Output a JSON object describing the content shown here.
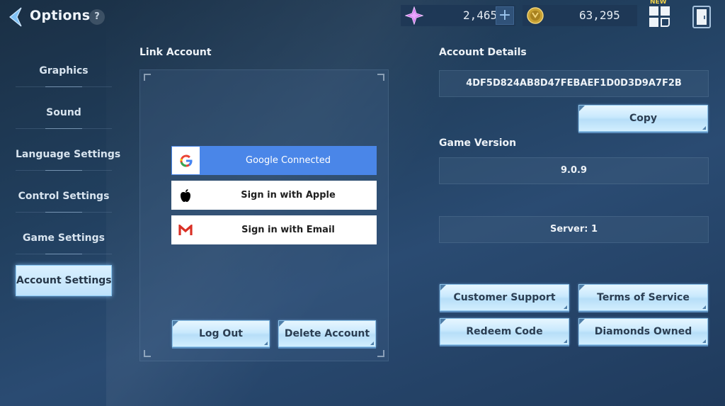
{
  "header": {
    "title": "Options",
    "help_label": "?",
    "back_icon": "chevron-left-icon",
    "currencies": [
      {
        "name": "diamonds",
        "icon": "purple-crystal-icon",
        "value": "2,465",
        "add_label": "+"
      },
      {
        "name": "gold",
        "icon": "gold-coin-icon",
        "value": "63,295"
      }
    ],
    "new_badge": "NEW",
    "menu_icon": "grid-menu-icon",
    "exit_icon": "door-exit-icon"
  },
  "sidebar": {
    "items": [
      {
        "label": "Graphics",
        "active": false
      },
      {
        "label": "Sound",
        "active": false
      },
      {
        "label": "Language Settings",
        "active": false
      },
      {
        "label": "Control Settings",
        "active": false
      },
      {
        "label": "Game Settings",
        "active": false
      },
      {
        "label": "Account Settings",
        "active": true
      }
    ]
  },
  "link_account": {
    "title": "Link Account",
    "providers": [
      {
        "label": "Google Connected",
        "icon": "google-icon",
        "connected": true,
        "color": "#4a86e8"
      },
      {
        "label": "Sign in with Apple",
        "icon": "apple-icon",
        "connected": false
      },
      {
        "label": "Sign in with Email",
        "icon": "gmail-icon",
        "connected": false
      }
    ],
    "logout_label": "Log Out",
    "delete_label": "Delete Account"
  },
  "account_details": {
    "title": "Account Details",
    "account_id": "4DF5D824AB8D47FEBAEF1D0D3D9A7F2B",
    "copy_label": "Copy",
    "version_title": "Game Version",
    "version": "9.0.9",
    "server": "Server: 1",
    "buttons": {
      "customer_support": "Customer Support",
      "terms": "Terms of Service",
      "redeem": "Redeem Code",
      "diamonds_owned": "Diamonds Owned"
    }
  }
}
